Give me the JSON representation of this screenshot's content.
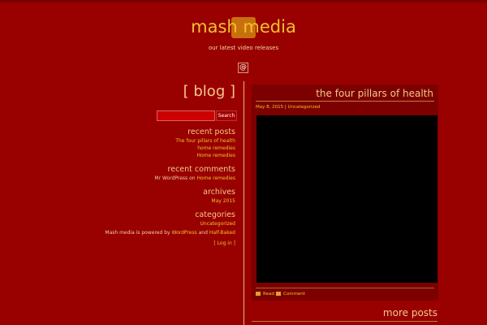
{
  "site": {
    "title": "mash media",
    "tagline": "our latest video releases",
    "contact_icon": "@"
  },
  "sidebar": {
    "heading": "[ blog ]",
    "search": {
      "placeholder": "",
      "button_label": "Search"
    },
    "recent_posts": {
      "heading": "recent posts",
      "items": [
        "The four pillars of health",
        "home remedies",
        "Home remedies"
      ]
    },
    "recent_comments": {
      "heading": "recent comments",
      "author": "Mr WordPress",
      "on": "on",
      "post": "Home remedies"
    },
    "archives": {
      "heading": "archives",
      "items": [
        "May 2015"
      ]
    },
    "categories": {
      "heading": "categories",
      "items": [
        "Uncategorized"
      ]
    },
    "footer": {
      "prefix": "Mash media is powered by",
      "link1": "WordPress",
      "and": "and",
      "link2": "Half-Baked"
    },
    "login": "[ Log in ]"
  },
  "post": {
    "title": "the four pillars of health",
    "date": "May 8, 2015",
    "separator": "|",
    "category": "Uncategorized",
    "read_label": "Read",
    "comment_label": "Comment"
  },
  "more_posts": "more posts",
  "colors": {
    "background": "#990000",
    "accent": "#f2c12e",
    "card": "#7c0000"
  }
}
